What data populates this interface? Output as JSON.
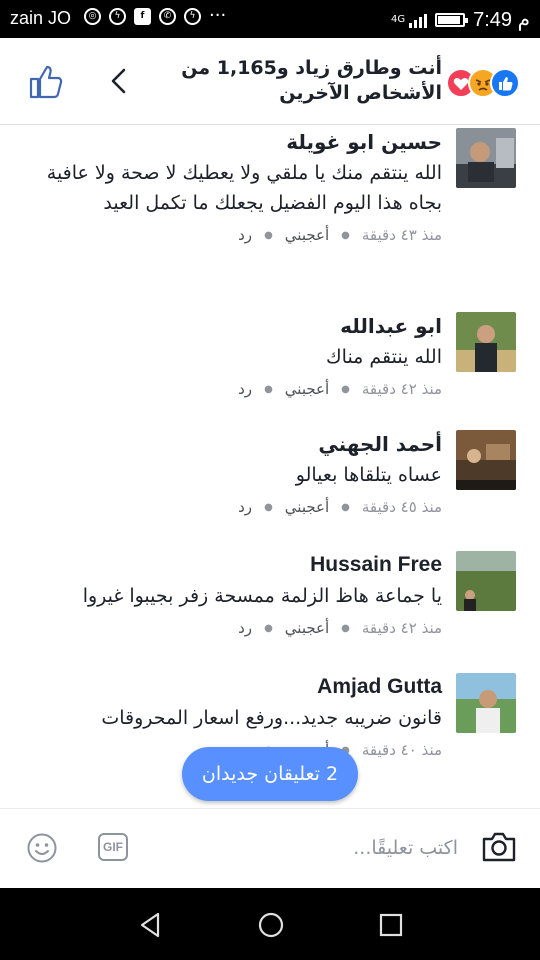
{
  "status_bar": {
    "carrier": "zain JO",
    "network": "4G",
    "time": "م 7:49",
    "battery_level": 0.9,
    "icons": [
      "camera-notification-icon",
      "messenger-icon",
      "facebook-icon",
      "whatsapp-icon",
      "messenger-icon",
      "more-dots-icon"
    ]
  },
  "header": {
    "title": "أنت وطارق زياد و1,165 من الأشخاص الآخرين",
    "reactions": [
      "like",
      "angry",
      "love"
    ],
    "colors": {
      "like": "#1877f2",
      "angry": "#f5a623",
      "love": "#f33e58"
    }
  },
  "comments": [
    {
      "author": "حسين ابو غويلة",
      "text": "الله ينتقم منك يا ملقي ولا يعطيك لا صحة ولا عافية بجاه هذا اليوم الفضيل يجعلك ما تكمل العيد",
      "time": "منذ ٤٣ دقيقة",
      "like_label": "أعجبني",
      "reply_label": "رد"
    },
    {
      "author": "ابو عبدالله",
      "text": "الله ينتقم مناك",
      "time": "منذ ٤٢ دقيقة",
      "like_label": "أعجبني",
      "reply_label": "رد"
    },
    {
      "author": "أحمد الجهني",
      "text": "عساه يتلقاها بعيالو",
      "time": "منذ ٤٥ دقيقة",
      "like_label": "أعجبني",
      "reply_label": "رد"
    },
    {
      "author": "Hussain Free",
      "text": "يا جماعة هاظ الزلمة ممسحة زفر بجيبوا غيروا",
      "time": "منذ ٤٢ دقيقة",
      "like_label": "أعجبني",
      "reply_label": "رد"
    },
    {
      "author": "Amjad Gutta",
      "text": "قانون ضريبه جديد...ورفع اسعار المحروقات",
      "time": "منذ ٤٠ دقيقة",
      "like_label": "أعجبني",
      "reply_label": "رد"
    }
  ],
  "new_comments_pill": "2 تعليقان جديدان",
  "composer": {
    "placeholder": "اكتب تعليقًا...",
    "gif_label": "GIF"
  },
  "colors": {
    "accent": "#5890ff",
    "text": "#1d2129",
    "meta": "#90949c"
  }
}
